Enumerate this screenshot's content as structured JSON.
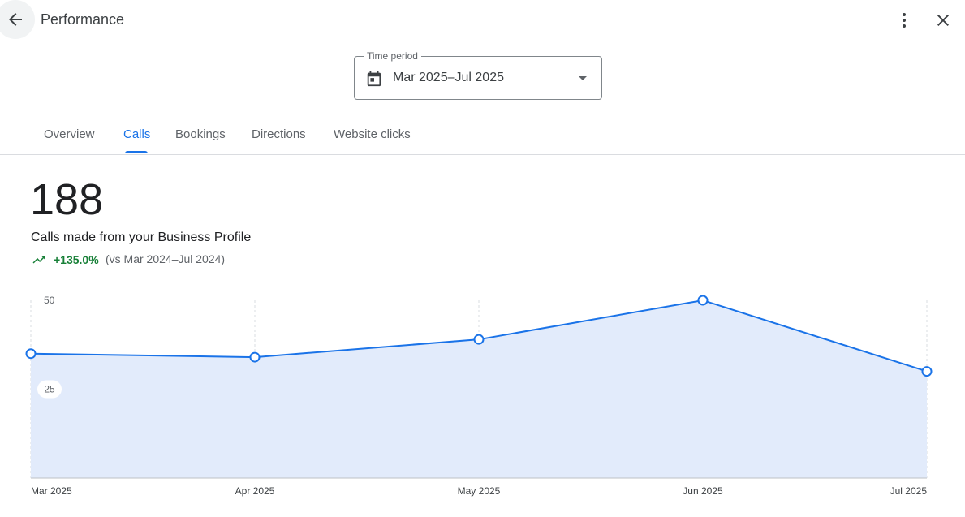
{
  "header": {
    "title": "Performance"
  },
  "time_period": {
    "label": "Time period",
    "value": "Mar 2025–Jul 2025"
  },
  "tabs": [
    {
      "label": "Overview",
      "active": false
    },
    {
      "label": "Calls",
      "active": true
    },
    {
      "label": "Bookings",
      "active": false
    },
    {
      "label": "Directions",
      "active": false
    },
    {
      "label": "Website clicks",
      "active": false
    }
  ],
  "metric": {
    "value": "188",
    "label": "Calls made from your Business Profile",
    "change": "+135.0%",
    "comparison": "(vs Mar 2024–Jul 2024)"
  },
  "colors": {
    "accent": "#1a73e8",
    "fill": "#e2ebfb",
    "positive": "#188038"
  },
  "icons": [
    "arrow-back-icon",
    "more-vert-icon",
    "close-icon",
    "calendar-icon",
    "dropdown-arrow-icon",
    "trending-up-icon"
  ],
  "chart_data": {
    "type": "area",
    "categories": [
      "Mar 2025",
      "Apr 2025",
      "May 2025",
      "Jun 2025",
      "Jul 2025"
    ],
    "values": [
      35,
      34,
      39,
      50,
      30
    ],
    "yticks": [
      "50",
      "25"
    ],
    "ylim": [
      0,
      50
    ],
    "grid": "vertical dashed"
  }
}
